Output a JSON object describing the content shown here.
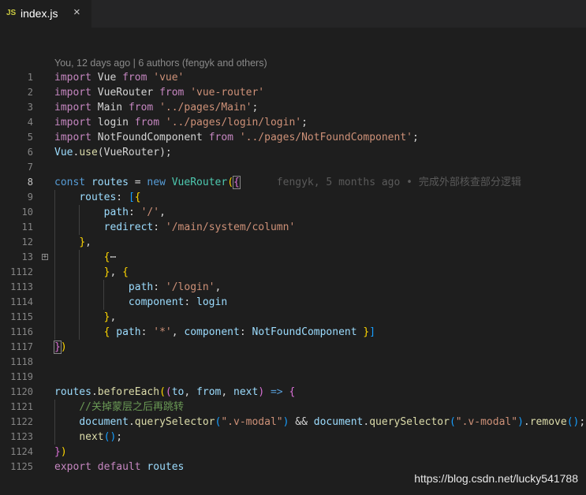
{
  "tab": {
    "icon_text": "JS",
    "filename": "index.js",
    "close_glyph": "×"
  },
  "blame_header": "You, 12 days ago | 6 authors (fengyk and others)",
  "inline_blame": "fengyk, 5 months ago • 完成外部核查部分逻辑",
  "watermark": "https://blog.csdn.net/lucky541788",
  "lines": [
    {
      "n": "1",
      "tokens": [
        [
          "kw",
          "import"
        ],
        [
          "id",
          " Vue "
        ],
        [
          "kw",
          "from"
        ],
        [
          "id",
          " "
        ],
        [
          "st",
          "'vue'"
        ]
      ]
    },
    {
      "n": "2",
      "tokens": [
        [
          "kw",
          "import"
        ],
        [
          "id",
          " VueRouter "
        ],
        [
          "kw",
          "from"
        ],
        [
          "id",
          " "
        ],
        [
          "st",
          "'vue-router'"
        ]
      ]
    },
    {
      "n": "3",
      "tokens": [
        [
          "kw",
          "import"
        ],
        [
          "id",
          " Main "
        ],
        [
          "kw",
          "from"
        ],
        [
          "id",
          " "
        ],
        [
          "st",
          "'../pages/Main'"
        ],
        [
          "id",
          ";"
        ]
      ]
    },
    {
      "n": "4",
      "tokens": [
        [
          "kw",
          "import"
        ],
        [
          "id",
          " login "
        ],
        [
          "kw",
          "from"
        ],
        [
          "id",
          " "
        ],
        [
          "st",
          "'../pages/login/login'"
        ],
        [
          "id",
          ";"
        ]
      ]
    },
    {
      "n": "5",
      "tokens": [
        [
          "kw",
          "import"
        ],
        [
          "id",
          " NotFoundComponent "
        ],
        [
          "kw",
          "from"
        ],
        [
          "id",
          " "
        ],
        [
          "st",
          "'../pages/NotFoundComponent'"
        ],
        [
          "id",
          ";"
        ]
      ]
    },
    {
      "n": "6",
      "tokens": [
        [
          "vr",
          "Vue"
        ],
        [
          "id",
          "."
        ],
        [
          "fn",
          "use"
        ],
        [
          "id",
          "(VueRouter);"
        ]
      ]
    },
    {
      "n": "7",
      "tokens": []
    },
    {
      "n": "8",
      "active": true,
      "tokens": [
        [
          "bl",
          "const"
        ],
        [
          "id",
          " "
        ],
        [
          "vr",
          "routes"
        ],
        [
          "id",
          " = "
        ],
        [
          "bl",
          "new"
        ],
        [
          "id",
          " "
        ],
        [
          "ty",
          "VueRouter"
        ],
        [
          "by",
          "("
        ],
        [
          "bp cursor-br",
          "{"
        ],
        [
          "inline",
          ""
        ]
      ]
    },
    {
      "n": "9",
      "guides": [
        1
      ],
      "tokens": [
        [
          "id",
          "    "
        ],
        [
          "vr",
          "routes"
        ],
        [
          "id",
          ": "
        ],
        [
          "bb",
          "["
        ],
        [
          "by",
          "{"
        ]
      ]
    },
    {
      "n": "10",
      "guides": [
        1,
        2
      ],
      "tokens": [
        [
          "id",
          "        "
        ],
        [
          "vr",
          "path"
        ],
        [
          "id",
          ": "
        ],
        [
          "st",
          "'/'"
        ],
        [
          "id",
          ","
        ]
      ]
    },
    {
      "n": "11",
      "guides": [
        1,
        2
      ],
      "tokens": [
        [
          "id",
          "        "
        ],
        [
          "vr",
          "redirect"
        ],
        [
          "id",
          ": "
        ],
        [
          "st",
          "'/main/system/column'"
        ]
      ]
    },
    {
      "n": "12",
      "guides": [
        1
      ],
      "tokens": [
        [
          "id",
          "    "
        ],
        [
          "by",
          "}"
        ],
        [
          "id",
          ","
        ]
      ]
    },
    {
      "n": "13",
      "fold": true,
      "guides": [
        1,
        2
      ],
      "tokens": [
        [
          "id",
          "        "
        ],
        [
          "by",
          "{"
        ],
        [
          "id",
          "⋯"
        ]
      ]
    },
    {
      "n": "1112",
      "guides": [
        1,
        2
      ],
      "tokens": [
        [
          "id",
          "        "
        ],
        [
          "by",
          "}"
        ],
        [
          "id",
          ", "
        ],
        [
          "by",
          "{"
        ]
      ]
    },
    {
      "n": "1113",
      "guides": [
        1,
        2,
        3
      ],
      "tokens": [
        [
          "id",
          "            "
        ],
        [
          "vr",
          "path"
        ],
        [
          "id",
          ": "
        ],
        [
          "st",
          "'/login'"
        ],
        [
          "id",
          ","
        ]
      ]
    },
    {
      "n": "1114",
      "guides": [
        1,
        2,
        3
      ],
      "tokens": [
        [
          "id",
          "            "
        ],
        [
          "vr",
          "component"
        ],
        [
          "id",
          ": "
        ],
        [
          "vr",
          "login"
        ]
      ]
    },
    {
      "n": "1115",
      "guides": [
        1,
        2
      ],
      "tokens": [
        [
          "id",
          "        "
        ],
        [
          "by",
          "}"
        ],
        [
          "id",
          ","
        ]
      ]
    },
    {
      "n": "1116",
      "guides": [
        1,
        2
      ],
      "tokens": [
        [
          "id",
          "        "
        ],
        [
          "by",
          "{"
        ],
        [
          "id",
          " "
        ],
        [
          "vr",
          "path"
        ],
        [
          "id",
          ": "
        ],
        [
          "st",
          "'*'"
        ],
        [
          "id",
          ", "
        ],
        [
          "vr",
          "component"
        ],
        [
          "id",
          ": "
        ],
        [
          "vr",
          "NotFoundComponent"
        ],
        [
          "id",
          " "
        ],
        [
          "by",
          "}"
        ],
        [
          "bb",
          "]"
        ]
      ]
    },
    {
      "n": "1117",
      "tokens": [
        [
          "bp cursor-br",
          "}"
        ],
        [
          "by",
          ")"
        ]
      ]
    },
    {
      "n": "1118",
      "tokens": []
    },
    {
      "n": "1119",
      "tokens": []
    },
    {
      "n": "1120",
      "tokens": [
        [
          "vr",
          "routes"
        ],
        [
          "id",
          "."
        ],
        [
          "fn",
          "beforeEach"
        ],
        [
          "by",
          "("
        ],
        [
          "bp",
          "("
        ],
        [
          "vr",
          "to"
        ],
        [
          "id",
          ", "
        ],
        [
          "vr",
          "from"
        ],
        [
          "id",
          ", "
        ],
        [
          "vr",
          "next"
        ],
        [
          "bp",
          ")"
        ],
        [
          "id",
          " "
        ],
        [
          "bl",
          "=>"
        ],
        [
          "id",
          " "
        ],
        [
          "bp",
          "{"
        ]
      ]
    },
    {
      "n": "1121",
      "guides": [
        1
      ],
      "tokens": [
        [
          "id",
          "    "
        ],
        [
          "cm",
          "//关掉蒙层之后再跳转"
        ]
      ]
    },
    {
      "n": "1122",
      "guides": [
        1
      ],
      "tokens": [
        [
          "id",
          "    "
        ],
        [
          "vr",
          "document"
        ],
        [
          "id",
          "."
        ],
        [
          "fn",
          "querySelector"
        ],
        [
          "bb",
          "("
        ],
        [
          "st",
          "\".v-modal\""
        ],
        [
          "bb",
          ")"
        ],
        [
          "id",
          " && "
        ],
        [
          "vr",
          "document"
        ],
        [
          "id",
          "."
        ],
        [
          "fn",
          "querySelector"
        ],
        [
          "bb",
          "("
        ],
        [
          "st",
          "\".v-modal\""
        ],
        [
          "bb",
          ")"
        ],
        [
          "id",
          "."
        ],
        [
          "fn",
          "remove"
        ],
        [
          "bb",
          "()"
        ],
        [
          "id",
          ";"
        ]
      ]
    },
    {
      "n": "1123",
      "guides": [
        1
      ],
      "tokens": [
        [
          "id",
          "    "
        ],
        [
          "fn",
          "next"
        ],
        [
          "bb",
          "()"
        ],
        [
          "id",
          ";"
        ]
      ]
    },
    {
      "n": "1124",
      "tokens": [
        [
          "bp",
          "}"
        ],
        [
          "by",
          ")"
        ]
      ]
    },
    {
      "n": "1125",
      "tokens": [
        [
          "kw",
          "export"
        ],
        [
          "id",
          " "
        ],
        [
          "kw",
          "default"
        ],
        [
          "id",
          " "
        ],
        [
          "vr",
          "routes"
        ]
      ]
    }
  ]
}
